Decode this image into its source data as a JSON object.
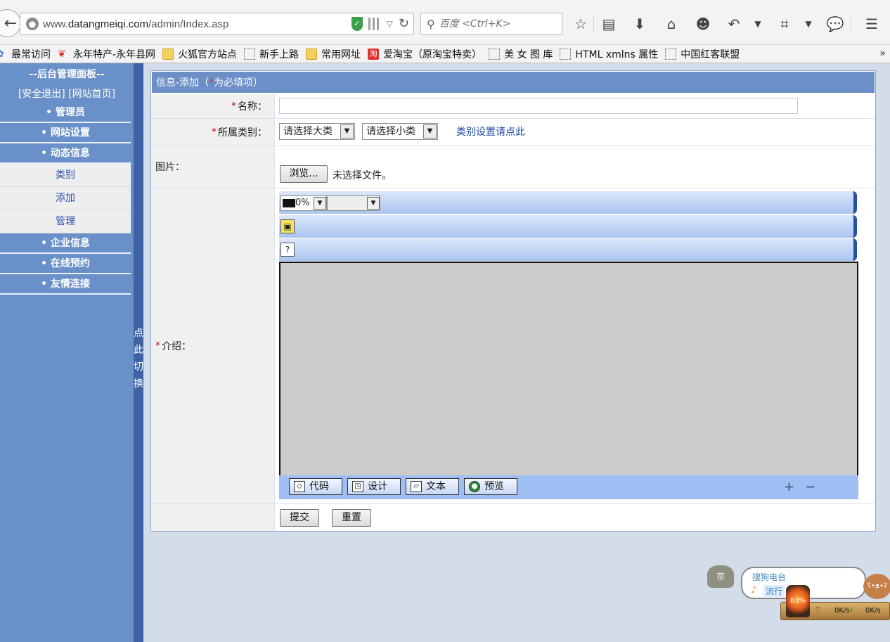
{
  "browser": {
    "url_prefix": "www.",
    "url_domain": "datangmeiqi.com",
    "url_path": "/admin/Index.asp",
    "search_placeholder": "百度 <Ctrl+K>",
    "bookmarks": [
      {
        "label": "最常访问",
        "icon": "gear-icon"
      },
      {
        "label": "永年特产-永年县网",
        "icon": "leaf-icon"
      },
      {
        "label": "火狐官方站点",
        "icon": "folder-icon"
      },
      {
        "label": "新手上路",
        "icon": "page-icon"
      },
      {
        "label": "常用网址",
        "icon": "folder-icon"
      },
      {
        "label": "爱淘宝（原淘宝特卖）",
        "icon": "taobao-icon"
      },
      {
        "label": "美 女 图 库",
        "icon": "page-icon"
      },
      {
        "label": "HTML xmlns 属性",
        "icon": "page-icon"
      },
      {
        "label": "中国红客联盟",
        "icon": "page-icon"
      }
    ],
    "more": "»"
  },
  "sidebar": {
    "title": "--后台管理面板--",
    "logout": "[安全退出]",
    "home": "[网站首页]",
    "menu": [
      {
        "label": "• 管理员"
      },
      {
        "label": "• 网站设置"
      },
      {
        "label": "• 动态信息"
      }
    ],
    "submenu": [
      {
        "label": "类别"
      },
      {
        "label": "添加"
      },
      {
        "label": "管理"
      }
    ],
    "menu2": [
      {
        "label": "• 企业信息"
      },
      {
        "label": "• 在线预约"
      },
      {
        "label": "• 友情连接"
      }
    ],
    "toggle": [
      "点",
      "此",
      "切",
      "换"
    ]
  },
  "form": {
    "header_title": "信息-添加",
    "header_paren_open": "（",
    "header_star": "*",
    "header_note": "为必填项）",
    "name_label": "名称：",
    "category_label": "所属类别：",
    "category_major": "请选择大类",
    "category_minor": "请选择小类",
    "category_link": "类别设置请点此",
    "image_label": "图片：",
    "browse_button": "浏览...",
    "no_file": "未选择文件。",
    "intro_label": "介绍：",
    "required_mark": "*",
    "submit_button": "提交",
    "reset_button": "重置"
  },
  "editor": {
    "zoom": "0%",
    "modes": [
      {
        "label": "代码",
        "icon": "code-icon"
      },
      {
        "label": "设计",
        "icon": "design-icon"
      },
      {
        "label": "文本",
        "icon": "text-icon"
      },
      {
        "label": "预览",
        "icon": "preview-icon"
      }
    ],
    "plus": "+",
    "minus": "−"
  },
  "widget": {
    "radio_title": "搜狗电台",
    "radio_tag": "流行",
    "percent": "83%",
    "up_speed": "0K/s",
    "down_speed": "0K/s"
  }
}
